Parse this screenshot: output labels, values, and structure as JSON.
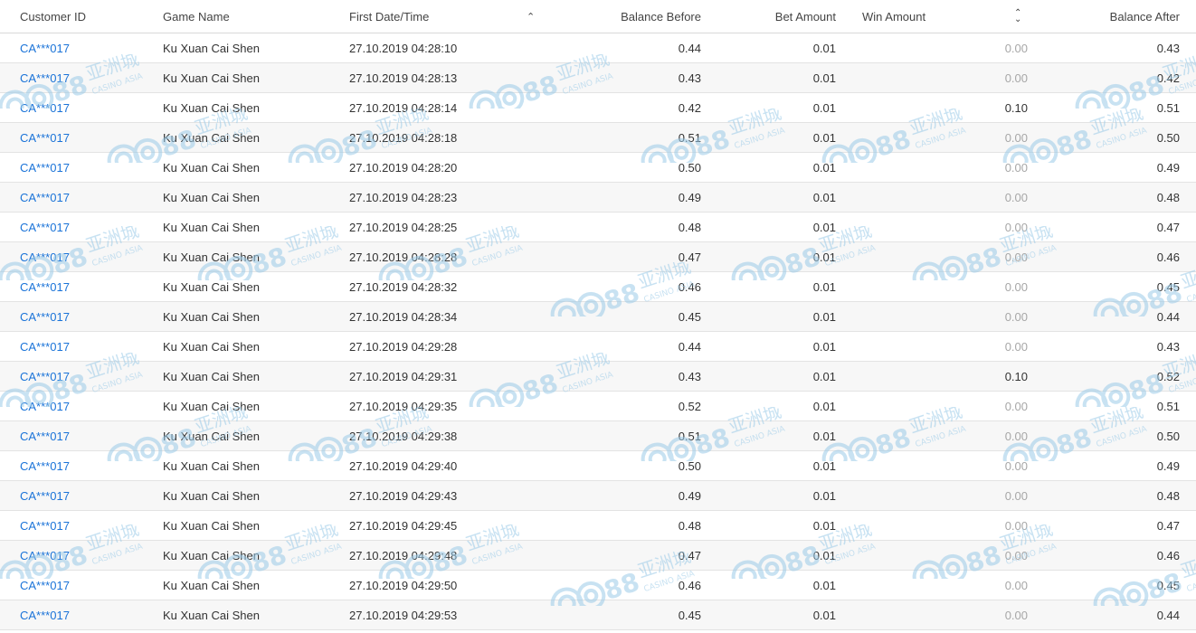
{
  "columns": {
    "customer_id": "Customer ID",
    "game_name": "Game Name",
    "first_datetime": "First Date/Time",
    "balance_before": "Balance Before",
    "bet_amount": "Bet Amount",
    "win_amount": "Win Amount",
    "balance_after": "Balance After"
  },
  "sort": {
    "first_datetime": "ascending",
    "win_amount": "unsorted"
  },
  "colors": {
    "link": "#1a73d8",
    "zero_value": "#a7a7a7",
    "watermark": "#9ccbe8"
  },
  "watermark": {
    "brand": "C188",
    "chinese": "亚洲城",
    "subtitle": "CASINO ASIA"
  },
  "rows": [
    {
      "customer_id": "CA***017",
      "game_name": "Ku Xuan Cai Shen",
      "datetime": "27.10.2019 04:28:10",
      "balance_before": "0.44",
      "bet_amount": "0.01",
      "win_amount": "0.00",
      "balance_after": "0.43"
    },
    {
      "customer_id": "CA***017",
      "game_name": "Ku Xuan Cai Shen",
      "datetime": "27.10.2019 04:28:13",
      "balance_before": "0.43",
      "bet_amount": "0.01",
      "win_amount": "0.00",
      "balance_after": "0.42"
    },
    {
      "customer_id": "CA***017",
      "game_name": "Ku Xuan Cai Shen",
      "datetime": "27.10.2019 04:28:14",
      "balance_before": "0.42",
      "bet_amount": "0.01",
      "win_amount": "0.10",
      "balance_after": "0.51"
    },
    {
      "customer_id": "CA***017",
      "game_name": "Ku Xuan Cai Shen",
      "datetime": "27.10.2019 04:28:18",
      "balance_before": "0.51",
      "bet_amount": "0.01",
      "win_amount": "0.00",
      "balance_after": "0.50"
    },
    {
      "customer_id": "CA***017",
      "game_name": "Ku Xuan Cai Shen",
      "datetime": "27.10.2019 04:28:20",
      "balance_before": "0.50",
      "bet_amount": "0.01",
      "win_amount": "0.00",
      "balance_after": "0.49"
    },
    {
      "customer_id": "CA***017",
      "game_name": "Ku Xuan Cai Shen",
      "datetime": "27.10.2019 04:28:23",
      "balance_before": "0.49",
      "bet_amount": "0.01",
      "win_amount": "0.00",
      "balance_after": "0.48"
    },
    {
      "customer_id": "CA***017",
      "game_name": "Ku Xuan Cai Shen",
      "datetime": "27.10.2019 04:28:25",
      "balance_before": "0.48",
      "bet_amount": "0.01",
      "win_amount": "0.00",
      "balance_after": "0.47"
    },
    {
      "customer_id": "CA***017",
      "game_name": "Ku Xuan Cai Shen",
      "datetime": "27.10.2019 04:28:28",
      "balance_before": "0.47",
      "bet_amount": "0.01",
      "win_amount": "0.00",
      "balance_after": "0.46"
    },
    {
      "customer_id": "CA***017",
      "game_name": "Ku Xuan Cai Shen",
      "datetime": "27.10.2019 04:28:32",
      "balance_before": "0.46",
      "bet_amount": "0.01",
      "win_amount": "0.00",
      "balance_after": "0.45"
    },
    {
      "customer_id": "CA***017",
      "game_name": "Ku Xuan Cai Shen",
      "datetime": "27.10.2019 04:28:34",
      "balance_before": "0.45",
      "bet_amount": "0.01",
      "win_amount": "0.00",
      "balance_after": "0.44"
    },
    {
      "customer_id": "CA***017",
      "game_name": "Ku Xuan Cai Shen",
      "datetime": "27.10.2019 04:29:28",
      "balance_before": "0.44",
      "bet_amount": "0.01",
      "win_amount": "0.00",
      "balance_after": "0.43"
    },
    {
      "customer_id": "CA***017",
      "game_name": "Ku Xuan Cai Shen",
      "datetime": "27.10.2019 04:29:31",
      "balance_before": "0.43",
      "bet_amount": "0.01",
      "win_amount": "0.10",
      "balance_after": "0.52"
    },
    {
      "customer_id": "CA***017",
      "game_name": "Ku Xuan Cai Shen",
      "datetime": "27.10.2019 04:29:35",
      "balance_before": "0.52",
      "bet_amount": "0.01",
      "win_amount": "0.00",
      "balance_after": "0.51"
    },
    {
      "customer_id": "CA***017",
      "game_name": "Ku Xuan Cai Shen",
      "datetime": "27.10.2019 04:29:38",
      "balance_before": "0.51",
      "bet_amount": "0.01",
      "win_amount": "0.00",
      "balance_after": "0.50"
    },
    {
      "customer_id": "CA***017",
      "game_name": "Ku Xuan Cai Shen",
      "datetime": "27.10.2019 04:29:40",
      "balance_before": "0.50",
      "bet_amount": "0.01",
      "win_amount": "0.00",
      "balance_after": "0.49"
    },
    {
      "customer_id": "CA***017",
      "game_name": "Ku Xuan Cai Shen",
      "datetime": "27.10.2019 04:29:43",
      "balance_before": "0.49",
      "bet_amount": "0.01",
      "win_amount": "0.00",
      "balance_after": "0.48"
    },
    {
      "customer_id": "CA***017",
      "game_name": "Ku Xuan Cai Shen",
      "datetime": "27.10.2019 04:29:45",
      "balance_before": "0.48",
      "bet_amount": "0.01",
      "win_amount": "0.00",
      "balance_after": "0.47"
    },
    {
      "customer_id": "CA***017",
      "game_name": "Ku Xuan Cai Shen",
      "datetime": "27.10.2019 04:29:48",
      "balance_before": "0.47",
      "bet_amount": "0.01",
      "win_amount": "0.00",
      "balance_after": "0.46"
    },
    {
      "customer_id": "CA***017",
      "game_name": "Ku Xuan Cai Shen",
      "datetime": "27.10.2019 04:29:50",
      "balance_before": "0.46",
      "bet_amount": "0.01",
      "win_amount": "0.00",
      "balance_after": "0.45"
    },
    {
      "customer_id": "CA***017",
      "game_name": "Ku Xuan Cai Shen",
      "datetime": "27.10.2019 04:29:53",
      "balance_before": "0.45",
      "bet_amount": "0.01",
      "win_amount": "0.00",
      "balance_after": "0.44"
    }
  ]
}
